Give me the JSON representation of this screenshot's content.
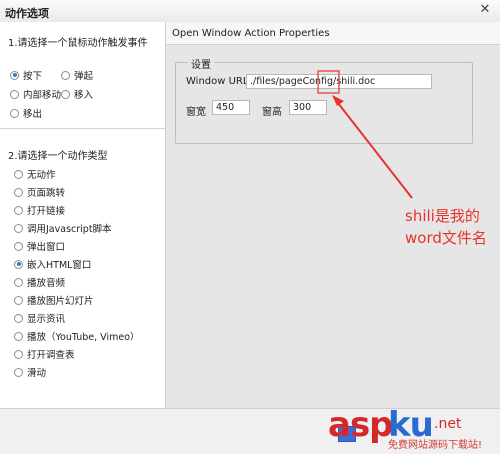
{
  "window": {
    "title": "动作选项",
    "close_glyph": "✕"
  },
  "left": {
    "section1": {
      "title": "1.请选择一个鼠标动作触发事件",
      "options": [
        {
          "label": "按下",
          "selected": true
        },
        {
          "label": "弹起",
          "selected": false
        },
        {
          "label": "内部移动",
          "selected": false
        },
        {
          "label": "移入",
          "selected": false
        },
        {
          "label": "移出",
          "selected": false
        }
      ]
    },
    "section2": {
      "title": "2.请选择一个动作类型",
      "options": [
        {
          "label": "无动作",
          "selected": false
        },
        {
          "label": "页面跳转",
          "selected": false
        },
        {
          "label": "打开链接",
          "selected": false
        },
        {
          "label": "调用Javascript脚本",
          "selected": false
        },
        {
          "label": "弹出窗口",
          "selected": false
        },
        {
          "label": "嵌入HTML窗口",
          "selected": true
        },
        {
          "label": "播放音频",
          "selected": false
        },
        {
          "label": "播放图片幻灯片",
          "selected": false
        },
        {
          "label": "显示资讯",
          "selected": false
        },
        {
          "label": "播放（YouTube, Vimeo）",
          "selected": false
        },
        {
          "label": "打开调查表",
          "selected": false
        },
        {
          "label": "滑动",
          "selected": false
        }
      ]
    }
  },
  "right": {
    "header": "Open Window Action Properties",
    "group_legend": "设置",
    "url_label": "Window URL:",
    "url_value": "./files/pageConfig/shili.doc",
    "width_label": "窗宽",
    "width_value": "450",
    "height_label": "窗高",
    "height_value": "300"
  },
  "annotation": {
    "line1": "shili是我的",
    "line2": "word文件名",
    "color": "#e8322c"
  },
  "watermark": {
    "main": "aspku",
    "net": ".net",
    "sub": "免费网站源码下载站!"
  },
  "colors": {
    "accent": "#2f7be0",
    "annotation": "#e8322c"
  }
}
